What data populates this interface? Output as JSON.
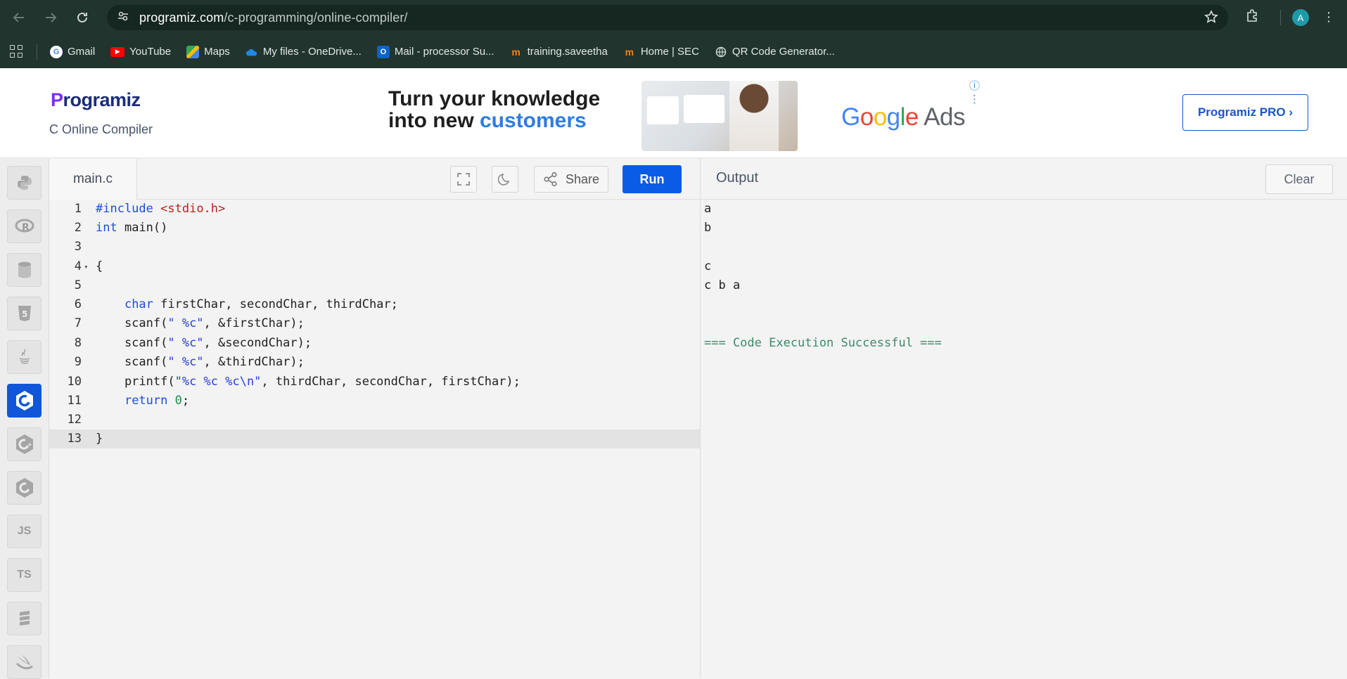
{
  "browser": {
    "url_host": "programiz.com",
    "url_path": "/c-programming/online-compiler/",
    "profile_initial": "A"
  },
  "bookmarks": [
    {
      "label": "Gmail",
      "icon": "google-icon"
    },
    {
      "label": "YouTube",
      "icon": "youtube-icon"
    },
    {
      "label": "Maps",
      "icon": "maps-icon"
    },
    {
      "label": "My files - OneDrive...",
      "icon": "onedrive-icon"
    },
    {
      "label": "Mail - processor Su...",
      "icon": "outlook-icon"
    },
    {
      "label": "training.saveetha",
      "icon": "moodle-icon"
    },
    {
      "label": "Home | SEC",
      "icon": "moodle-icon"
    },
    {
      "label": "QR Code Generator...",
      "icon": "globe-icon"
    }
  ],
  "header": {
    "logo": "Programiz",
    "logo_first": "P",
    "logo_rest": "rogramiz",
    "subtitle": "C Online Compiler",
    "pro_button": "Programiz PRO ›"
  },
  "ad": {
    "line1": "Turn your knowledge",
    "line2_a": "into new ",
    "line2_b": "customers",
    "brand_g": "G",
    "brand_o1": "o",
    "brand_o2": "o",
    "brand_g2": "g",
    "brand_l": "l",
    "brand_e": "e",
    "brand_rest": " Ads"
  },
  "sidebar": {
    "languages": [
      "python-icon",
      "r-icon",
      "sql-icon",
      "html-icon",
      "java-icon",
      "c-icon",
      "cpp-icon",
      "csharp-icon",
      "js-icon",
      "ts-icon",
      "go-icon",
      "swift-icon"
    ],
    "js_label": "JS",
    "ts_label": "TS",
    "active": "c-icon"
  },
  "editor": {
    "filename": "main.c",
    "share_label": "Share",
    "run_label": "Run",
    "line_numbers": [
      "1",
      "2",
      "3",
      "4",
      "5",
      "6",
      "7",
      "8",
      "9",
      "10",
      "11",
      "12",
      "13"
    ],
    "lines": [
      "#include <stdio.h>",
      "int main()",
      "",
      "{",
      "",
      "    char firstChar, secondChar, thirdChar;",
      "    scanf(\" %c\", &firstChar);",
      "    scanf(\" %c\", &secondChar);",
      "    scanf(\" %c\", &thirdChar);",
      "    printf(\"%c %c %c\\n\", thirdChar, secondChar, firstChar);",
      "    return 0;",
      "",
      "}"
    ]
  },
  "output": {
    "title": "Output",
    "clear_label": "Clear",
    "lines": [
      "a",
      "b",
      "",
      "c",
      "c b a",
      "",
      "",
      "=== Code Execution Successful ==="
    ]
  },
  "colors": {
    "accent": "#0a5ce6",
    "chrome": "#21342e",
    "success": "#3d8a69"
  }
}
